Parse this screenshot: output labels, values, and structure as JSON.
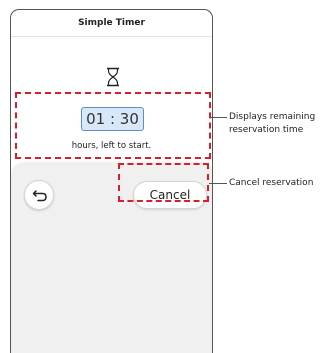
{
  "app": {
    "title": "Simple Timer"
  },
  "timer": {
    "icon": "hourglass-icon",
    "time": "01 : 30",
    "subtitle": "hours, left to start."
  },
  "controls": {
    "back_icon": "back-arrow-icon",
    "cancel_label": "Cancel"
  },
  "annotations": {
    "time": "Displays remaining reservation time",
    "cancel": "Cancel reservation"
  },
  "colors": {
    "highlight_dash": "#d81e28",
    "time_box_bg": "#d8e8f8",
    "time_box_border": "#5b8fc7",
    "panel_bg": "#f0f0f0"
  }
}
